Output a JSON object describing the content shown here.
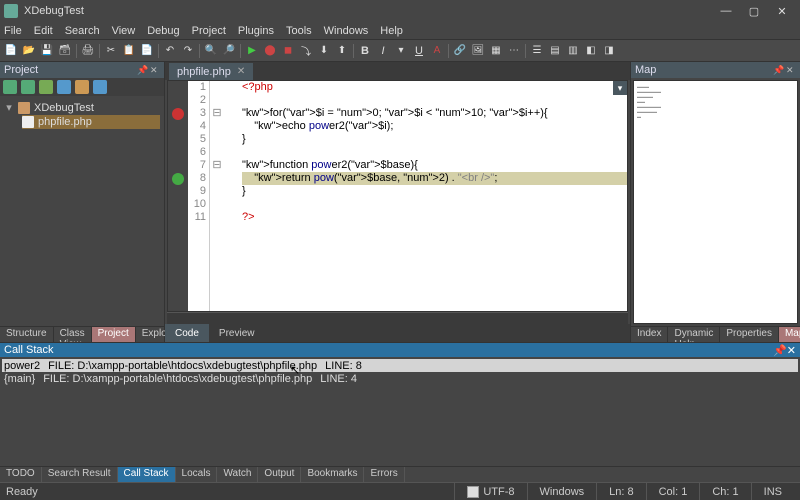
{
  "window": {
    "title": "XDebugTest"
  },
  "menu": [
    "File",
    "Edit",
    "Search",
    "View",
    "Debug",
    "Project",
    "Plugins",
    "Tools",
    "Windows",
    "Help"
  ],
  "panels": {
    "project": "Project",
    "map": "Map",
    "callstack": "Call Stack"
  },
  "project": {
    "root": "XDebugTest",
    "file": "phpfile.php"
  },
  "editor": {
    "tab": "phpfile.php",
    "dropdown": "▾",
    "lines": [
      {
        "n": 1,
        "c": "<?php",
        "cls": "php"
      },
      {
        "n": 2,
        "c": ""
      },
      {
        "n": 3,
        "bp": "r",
        "fold": "⊟",
        "c": "for($i = 0; $i < 10; $i++){"
      },
      {
        "n": 4,
        "c": "    echo power2($i);"
      },
      {
        "n": 5,
        "c": "}"
      },
      {
        "n": 6,
        "c": ""
      },
      {
        "n": 7,
        "fold": "⊟",
        "c": "function power2($base){"
      },
      {
        "n": 8,
        "bp": "g",
        "hl": true,
        "c": "    return pow($base, 2) . \"<br />\";"
      },
      {
        "n": 9,
        "c": "}"
      },
      {
        "n": 10,
        "c": ""
      },
      {
        "n": 11,
        "c": "?>",
        "cls": "php"
      }
    ]
  },
  "center_tabs": {
    "code": "Code",
    "preview": "Preview"
  },
  "left_tabs": [
    "Structure",
    "Class View",
    "Project",
    "Explorer"
  ],
  "left_active": "Project",
  "right_tabs": [
    "Index",
    "Dynamic Help",
    "Properties",
    "Map"
  ],
  "right_active": "Map",
  "callstack": {
    "rows": [
      {
        "fn": "power2",
        "file": "FILE: D:\\xampp-portable\\htdocs\\xdebugtest\\phpfile.php",
        "line": "LINE: 8",
        "sel": true
      },
      {
        "fn": "{main}",
        "file": "FILE: D:\\xampp-portable\\htdocs\\xdebugtest\\phpfile.php",
        "line": "LINE: 4"
      }
    ]
  },
  "bottom_tabs": [
    "TODO",
    "Search Result",
    "Call Stack",
    "Locals",
    "Watch",
    "Output",
    "Bookmarks",
    "Errors"
  ],
  "bottom_active": "Call Stack",
  "status": {
    "ready": "Ready",
    "enc": "UTF-8",
    "eol": "Windows",
    "line": "Ln: 8",
    "col": "Col: 1",
    "ch": "Ch: 1",
    "mode": "INS"
  }
}
